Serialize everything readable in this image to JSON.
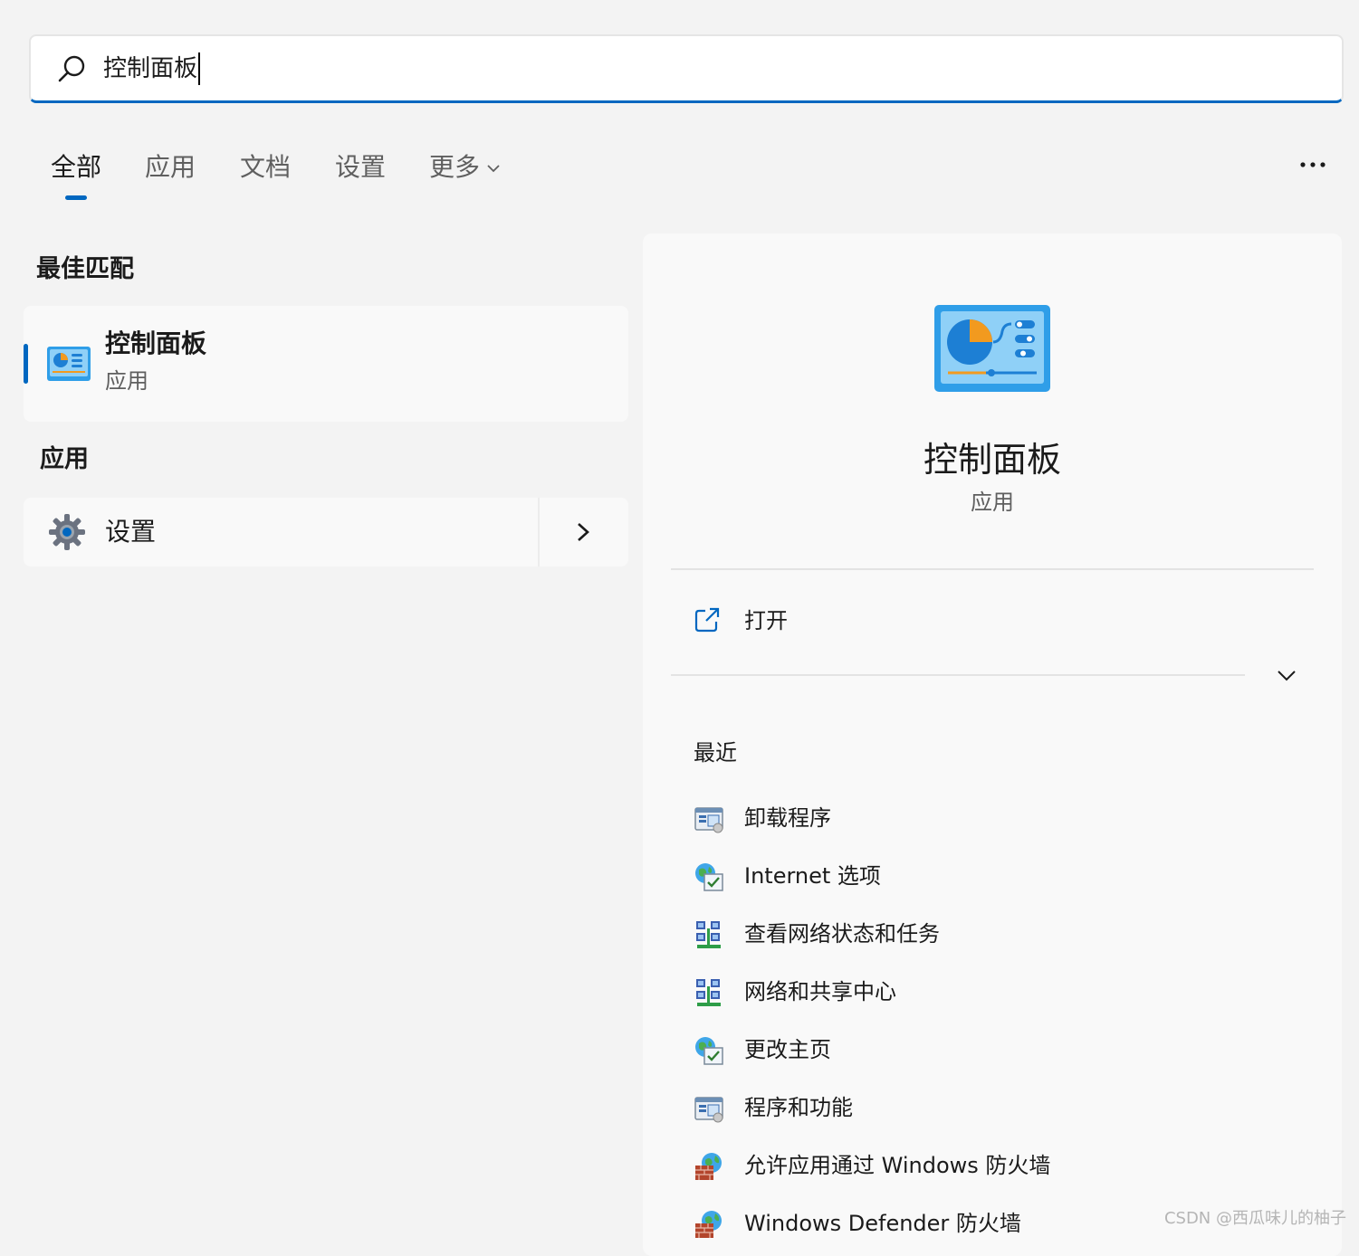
{
  "search": {
    "query": "控制面板"
  },
  "tabs": [
    {
      "label": "全部"
    },
    {
      "label": "应用"
    },
    {
      "label": "文档"
    },
    {
      "label": "设置"
    },
    {
      "label": "更多"
    }
  ],
  "left": {
    "best_match_header": "最佳匹配",
    "best_match": {
      "title": "控制面板",
      "subtitle": "应用"
    },
    "apps_header": "应用",
    "apps": [
      {
        "label": "设置"
      }
    ]
  },
  "detail": {
    "title": "控制面板",
    "subtitle": "应用",
    "open_label": "打开",
    "recent_header": "最近",
    "recent": [
      {
        "label": "卸载程序",
        "icon": "programs-icon"
      },
      {
        "label": "Internet 选项",
        "icon": "internet-options-icon"
      },
      {
        "label": "查看网络状态和任务",
        "icon": "network-icon"
      },
      {
        "label": "网络和共享中心",
        "icon": "network-icon"
      },
      {
        "label": "更改主页",
        "icon": "internet-options-icon"
      },
      {
        "label": "程序和功能",
        "icon": "programs-icon"
      },
      {
        "label": "允许应用通过 Windows 防火墙",
        "icon": "firewall-icon"
      },
      {
        "label": "Windows Defender 防火墙",
        "icon": "firewall-icon"
      }
    ]
  },
  "watermark": "CSDN @西瓜味儿的柚子",
  "colors": {
    "accent": "#0067c0",
    "background": "#f3f3f3",
    "card": "#f9f9f9"
  }
}
